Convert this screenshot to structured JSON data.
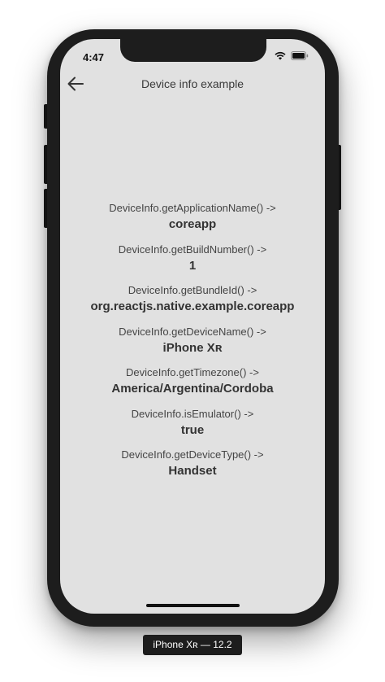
{
  "status_bar": {
    "time": "4:47"
  },
  "header": {
    "title": "Device info example"
  },
  "info_items": [
    {
      "label": "DeviceInfo.getApplicationName() ->",
      "value": "coreapp"
    },
    {
      "label": "DeviceInfo.getBuildNumber() ->",
      "value": "1"
    },
    {
      "label": "DeviceInfo.getBundleId() ->",
      "value": "org.reactjs.native.example.coreapp"
    },
    {
      "label": "DeviceInfo.getDeviceName() ->",
      "value": "iPhone Xʀ"
    },
    {
      "label": "DeviceInfo.getTimezone() ->",
      "value": "America/Argentina/Cordoba"
    },
    {
      "label": "DeviceInfo.isEmulator() ->",
      "value": "true"
    },
    {
      "label": "DeviceInfo.getDeviceType() ->",
      "value": "Handset"
    }
  ],
  "device_caption": "iPhone Xʀ — 12.2",
  "icons": {
    "back": "back-arrow-icon",
    "wifi": "wifi-icon",
    "battery": "battery-icon"
  },
  "colors": {
    "screen_bg": "#e1e1e1",
    "frame": "#1d1d1d",
    "text": "#333333"
  }
}
